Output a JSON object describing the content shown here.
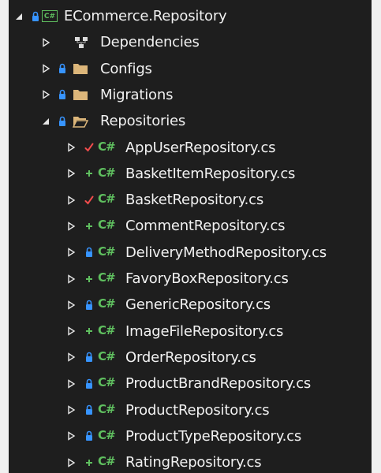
{
  "colors": {
    "background": "#1e1e1e",
    "text": "#f1f1f1",
    "lock": "#3794ff",
    "checkmark": "#f14c4c",
    "added": "#5fbf5f",
    "csharp": "#5fbf5f",
    "folder": "#dcb67a"
  },
  "solution_explorer": {
    "project": {
      "name": "ECommerce.Repository",
      "icon_text": "C#",
      "status": "lock-icon",
      "expanded": true
    },
    "dependencies": {
      "label": "Dependencies",
      "icon": "dependencies-icon"
    },
    "folders": [
      {
        "label": "Configs",
        "status": "lock-icon",
        "expanded": false
      },
      {
        "label": "Migrations",
        "status": "lock-icon",
        "expanded": false
      },
      {
        "label": "Repositories",
        "status": "lock-icon",
        "expanded": true
      }
    ],
    "files": [
      {
        "label": "AppUserRepository.cs",
        "status": "checkmark-icon"
      },
      {
        "label": "BasketItemRepository.cs",
        "status": "plus-icon"
      },
      {
        "label": "BasketRepository.cs",
        "status": "checkmark-icon"
      },
      {
        "label": "CommentRepository.cs",
        "status": "plus-icon"
      },
      {
        "label": "DeliveryMethodRepository.cs",
        "status": "lock-icon"
      },
      {
        "label": "FavoryBoxRepository.cs",
        "status": "plus-icon"
      },
      {
        "label": "GenericRepository.cs",
        "status": "lock-icon"
      },
      {
        "label": "ImageFileRepository.cs",
        "status": "plus-icon"
      },
      {
        "label": "OrderRepository.cs",
        "status": "lock-icon"
      },
      {
        "label": "ProductBrandRepository.cs",
        "status": "lock-icon"
      },
      {
        "label": "ProductRepository.cs",
        "status": "lock-icon"
      },
      {
        "label": "ProductTypeRepository.cs",
        "status": "lock-icon"
      },
      {
        "label": "RatingRepository.cs",
        "status": "plus-icon"
      }
    ],
    "file_icon_text": "C#"
  }
}
